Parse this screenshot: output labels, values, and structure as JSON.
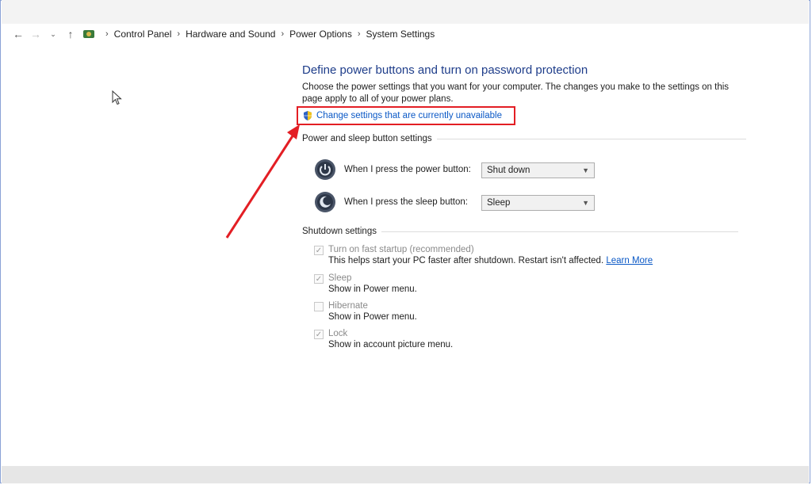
{
  "breadcrumb": {
    "items": [
      "Control Panel",
      "Hardware and Sound",
      "Power Options",
      "System Settings"
    ]
  },
  "page": {
    "title": "Define power buttons and turn on password protection",
    "description": "Choose the power settings that you want for your computer. The changes you make to the settings on this page apply to all of your power plans.",
    "change_link": "Change settings that are currently unavailable"
  },
  "power_sleep": {
    "heading": "Power and sleep button settings",
    "power_label": "When I press the power button:",
    "power_value": "Shut down",
    "sleep_label": "When I press the sleep button:",
    "sleep_value": "Sleep"
  },
  "shutdown": {
    "heading": "Shutdown settings",
    "items": [
      {
        "label": "Turn on fast startup (recommended)",
        "note": "This helps start your PC faster after shutdown. Restart isn't affected.",
        "checked": true
      },
      {
        "label": "Sleep",
        "note": "Show in Power menu.",
        "checked": true
      },
      {
        "label": "Hibernate",
        "note": "Show in Power menu.",
        "checked": false
      },
      {
        "label": "Lock",
        "note": "Show in account picture menu.",
        "checked": true
      }
    ],
    "learn_more": "Learn More"
  },
  "colors": {
    "title": "#1e3d8a",
    "link": "#0a58c6",
    "highlight": "#e31e24"
  }
}
